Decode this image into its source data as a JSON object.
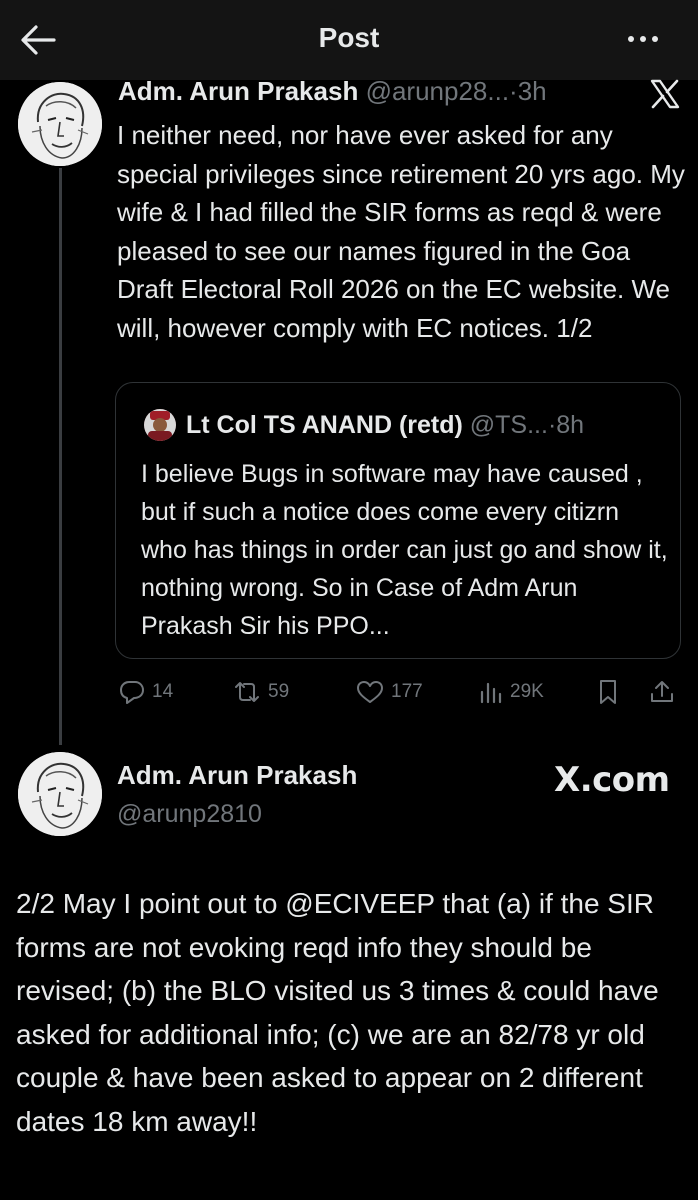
{
  "header": {
    "title": "Post",
    "back_icon": "arrow-left-icon",
    "more_icon": "more-horizontal-icon"
  },
  "tweet1": {
    "name": "Adm. Arun Prakash",
    "handle": "@arunp28...",
    "separator": "·",
    "time": "3h",
    "text": "I neither need, nor have ever asked for any special privileges since retirement 20 yrs ago. My wife & I had filled the SIR forms as reqd & were pleased to see our names figured in the Goa Draft Electoral Roll 2026 on the EC website. We will, however comply with EC notices. 1/2",
    "quote": {
      "name": "Lt Col TS ANAND (retd)",
      "handle": "@TS...",
      "separator": "·",
      "time": "8h",
      "text": "I believe Bugs in software may have caused , but if such a notice does come every citizrn who has things in order can just go and show it, nothing wrong. So in Case of Adm Arun Prakash Sir his PPO..."
    },
    "actions": {
      "replies": "14",
      "reposts": "59",
      "likes": "177",
      "views": "29K"
    }
  },
  "tweet2": {
    "name": "Adm. Arun Prakash",
    "handle": "@arunp2810",
    "brand": "X.com",
    "text": "2/2 May I point out to @ECIVEEP that (a) if the SIR forms are not evoking reqd info they should be revised; (b) the BLO visited us 3 times & could have asked for additional info; (c) we are an 82/78 yr old couple & have been asked to appear on 2 different dates 18 km away!!"
  },
  "colors": {
    "background": "#000000",
    "text": "#e7e9ea",
    "muted": "#71767b",
    "border": "#2f3336",
    "topbar": "#141414"
  }
}
